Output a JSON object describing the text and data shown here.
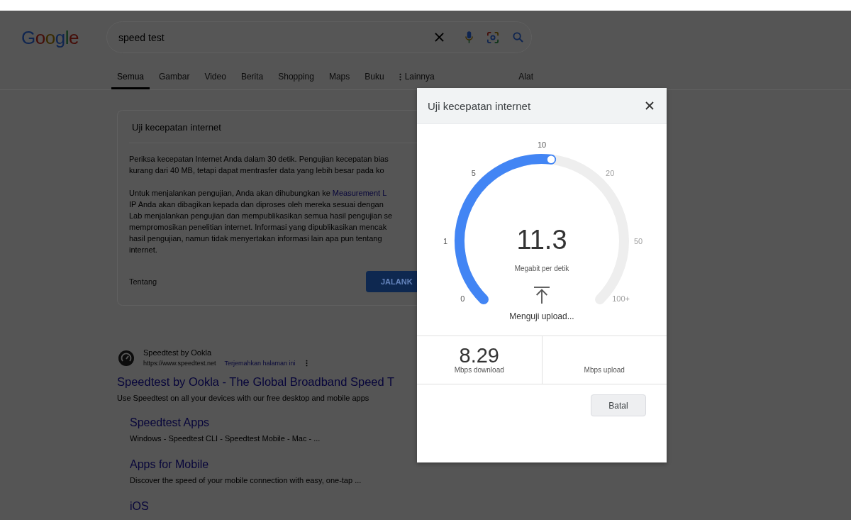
{
  "header": {
    "logo": "Google",
    "search": {
      "value": "speed test"
    }
  },
  "tabs": [
    {
      "label": "Semua",
      "kind": "category",
      "selected": true
    },
    {
      "label": "Gambar",
      "kind": "category",
      "selected": false
    },
    {
      "label": "Video",
      "kind": "category",
      "selected": false
    },
    {
      "label": "Berita",
      "kind": "category",
      "selected": false
    },
    {
      "label": "Shopping",
      "kind": "category",
      "selected": false
    },
    {
      "label": "Maps",
      "kind": "category",
      "selected": false
    },
    {
      "label": "Buku",
      "kind": "category",
      "selected": false
    },
    {
      "label": "Lainnya",
      "kind": "more",
      "selected": false
    },
    {
      "label": "Alat",
      "kind": "tools",
      "selected": false
    }
  ],
  "speed_card": {
    "title": "Uji kecepatan internet",
    "paragraphs": [
      [
        {
          "text": "Periksa kecepatan Internet Anda dalam 30 detik. Pengujian kecepatan bias"
        },
        {
          "text": "kurang dari 40 MB, tetapi dapat mentrasfer data yang lebih besar pada ko"
        }
      ],
      [
        {
          "text": "Untuk menjalankan pengujian, Anda akan dihubungkan ke ",
          "link": "Measurement L"
        },
        {
          "text": "IP Anda akan dibagikan kepada dan diproses oleh mereka sesuai dengan"
        },
        {
          "text": "Lab menjalankan pengujian dan mempublikasikan semua hasil pengujian se"
        },
        {
          "text": "mempromosikan penelitian internet. Informasi yang dipublikasikan mencak"
        },
        {
          "text": "hasil pengujian, namun tidak menyertakan informasi lain apa pun tentang"
        },
        {
          "text": "internet."
        }
      ]
    ],
    "about_link": "Tentang",
    "run_button": "JALANK"
  },
  "results": [
    {
      "site_name": "Speedtest by Ookla",
      "url": "https://www.speedtest.net",
      "translate": "Terjemahkan halaman ini",
      "title": "Speedtest by Ookla - The Global Broadband Speed T",
      "snippet": "Use Speedtest on all your devices with our free desktop and mobile apps",
      "sitelinks": [
        {
          "title": "Speedtest Apps",
          "snippet": "Windows - Speedtest CLI - Speedtest Mobile - Mac - ..."
        },
        {
          "title": "Apps for Mobile",
          "snippet": "Discover the speed of your mobile connection with easy, one-tap ..."
        },
        {
          "title": "iOS"
        }
      ]
    }
  ],
  "dialog": {
    "title": "Uji kecepatan internet",
    "gauge": {
      "scale": [
        "0",
        "1",
        "5",
        "10",
        "20",
        "50",
        "100+"
      ],
      "level": 0.524,
      "value": "11.3",
      "unit": "Megabit per detik",
      "status": "Menguji upload..."
    },
    "readings": [
      {
        "value": "8.29",
        "label": "Mbps download"
      },
      {
        "label": "Mbps upload"
      }
    ],
    "cancel_button": "Batal"
  }
}
